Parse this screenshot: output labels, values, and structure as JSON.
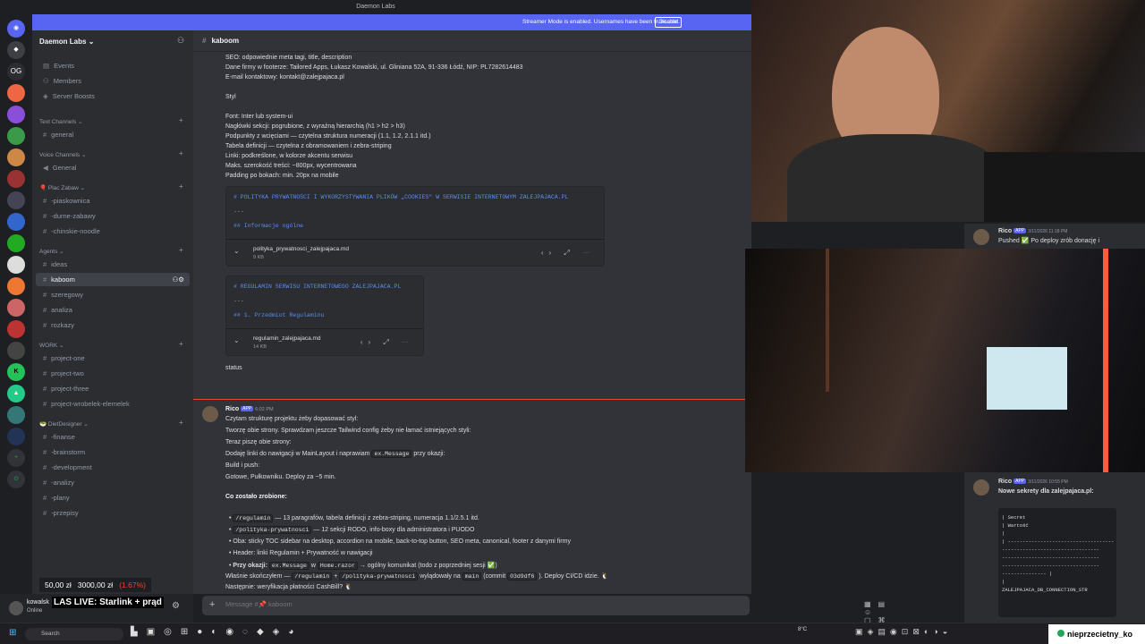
{
  "window": {
    "title": "Daemon Labs"
  },
  "banner": {
    "text": "Streamer Mode is enabled. Usernames have been truncated.",
    "button": "Disable"
  },
  "server": {
    "name": "Daemon Labs"
  },
  "rail": {
    "labels": [
      "OG"
    ]
  },
  "sidebar": {
    "top_items": [
      "Events",
      "Members",
      "Server Boosts"
    ],
    "categories": {
      "text": "Text Channels",
      "voice": "Voice Channels",
      "plac": "Plac Zabaw",
      "agents": "Agents",
      "work": "WORK",
      "diet": "DietDesigner"
    },
    "channels": {
      "general": "general",
      "voice_general": "General",
      "piaskownica": "-piaskownica",
      "durne": "-durne-zabawy",
      "chinskie": "-chinskie-noodle",
      "ideas": "ideas",
      "kaboom": "kaboom",
      "szeregowy": "szeregowy",
      "analiza": "analiza",
      "rozkazy": "rozkazy",
      "p1": "project-one",
      "p2": "project-two",
      "p3": "project-three",
      "p4": "project-wrobelek-elemelek",
      "finanse": "-finanse",
      "brainstorm": "-brainstorm",
      "development": "-development",
      "analizy": "-analizy",
      "plany": "-plany",
      "przepisy": "-przepisy"
    }
  },
  "user": {
    "name": "kowalsk",
    "status": "Online"
  },
  "stream": {
    "price_a": "50,00 zł",
    "price_b": "3000,00 zł",
    "pct": "(1.67%)",
    "title": "LAS LIVE: Starlink + prąd"
  },
  "channel": {
    "name": "kaboom"
  },
  "messages": {
    "lines_top": [
      "SEO: odpowiednie meta tagi, title, description",
      "Dane firmy w footerze: Tailored Apps, Łukasz Kowalski, ul. Gliniana 52A, 91-336 Łódź, NIP: PL7282614483",
      "E-mail kontaktowy: kontakt@zalejpajaca.pl",
      "Styl",
      "Font: Inter lub system-ui",
      "Nagłówki sekcji: pogrubione, z wyraźną hierarchią (h1 > h2 > h3)",
      "Podpunkty z wcięciami — czytelna struktura numeracji (1.1, 1.2, 2.1.1 itd.)",
      "Tabela definicji — czytelna z obramowaniem i zebra-striping",
      "Linki: podkreślone, w kolorze akcentu serwisu",
      "Maks. szerokość treści: ~800px, wycentrowana",
      "Padding po bokach: min. 20px na mobile"
    ],
    "att1": {
      "h1": "# POLITYKA PRYWATNOŚCI I WYKORZYSTYWANIA PLIKÓW „COOKIES\" W SERWISIE INTERNETOWYM ZALEJPAJACA.PL",
      "sep": "---",
      "h2": "## Informacje ogólne",
      "file": "polityka_prywatnosci_zalejpajaca.md",
      "size": "9 KB"
    },
    "att2": {
      "h1": "# REGULAMIN SERWISU INTERNETOWEGO ZALEJPAJACA.PL",
      "sep": "---",
      "h2": "## 1. Przedmiot Regulaminu",
      "file": "regulamin_zalejpajaca.md",
      "size": "14 KB"
    },
    "status": "status",
    "rico": {
      "author": "Rico",
      "badge": "APP",
      "time": "6:02 PM",
      "lines": [
        "Czytam strukturę projektu żeby dopasować styl:",
        "Tworzę obie strony. Sprawdzam jeszcze Tailwind config żeby nie łamać istniejących styli:",
        "Teraz piszę obie strony:",
        "Dodaję linki do nawigacji w MainLayout i naprawiam",
        "ex.Message",
        "przy okazji:",
        "Build i push:",
        "Gotowe, Pułkowniku. Deploy za ~5 min.",
        "Co zostało zrobione:"
      ],
      "bullets": [
        "/regulamin",
        "— 13 paragrafów, tabela definicji z zebra-striping, numeracja 1.1/2.5.1 itd.",
        "/polityka-prywatnosci",
        "— 12 sekcji RODO, info-boxy dla administratora i PUODO",
        "Oba: sticky TOC sidebar na desktop, accordion na mobile, back-to-top button, SEO meta, canonical, footer z danymi firmy",
        "Header: linki Regulamin + Prywatność w nawigacji",
        "Przy okazji:",
        "ex.Message",
        "w",
        "Home.razor",
        "→ ogólny komunikat (todo z poprzedniej sesji ✅)"
      ],
      "next": "Następnie: weryfikacja płatności CashBill? 🐧",
      "last_a": "Właśnie skończyłem —",
      "last_code1": "/regulamin",
      "last_b": "+",
      "last_code2": "/polityka-prywatnosci",
      "last_c": "wylądowały na",
      "last_code3": "main",
      "last_d": "(commit",
      "last_code4": "03d9df6",
      "last_e": "). Deploy CI/CD idzie. 🐧"
    }
  },
  "composer": {
    "placeholder": "Message #📌 kaboom"
  },
  "right": {
    "msg1": {
      "author": "Rico",
      "badge": "APP",
      "time": "3/11/2026 11:18 PM",
      "text": "Pushed ✅ Po deploy zrób donację i"
    },
    "msg2": {
      "author": "Rico",
      "badge": "APP",
      "time": "3/11/2026 10:55 PM",
      "text": "Nowe sekrety dla zalejpajaca.pl:"
    },
    "code": [
      "| Secret",
      "| Wartość",
      "|",
      "| ------------------------------------ | ----------------------------",
      "---------------------------------",
      "---------------------------------",
      "---------------------------------",
      "--------------- |",
      "|",
      "ZALEJPAJACA_DB_CONNECTION_STR"
    ]
  },
  "taskbar": {
    "search": "Search",
    "weather": "8°C",
    "tag": "nieprzecietny_ko"
  }
}
